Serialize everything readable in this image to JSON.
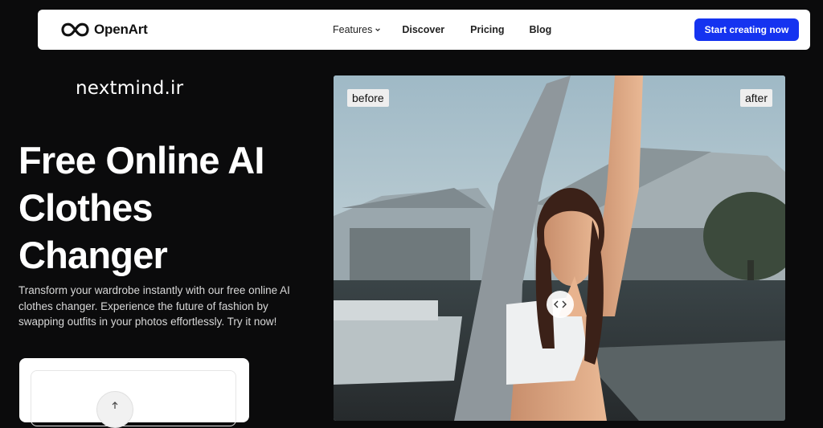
{
  "nav": {
    "brand": "OpenArt",
    "links": [
      "Features",
      "Discover",
      "Pricing",
      "Blog"
    ],
    "cta": "Start creating now"
  },
  "watermark": "nextmind.ir",
  "hero": {
    "title_lines": [
      "Free Online AI",
      "Clothes",
      "Changer"
    ],
    "subtitle": "Transform your wardrobe instantly with our free online AI clothes changer. Experience the future of fashion by swapping outfits in your photos effortlessly. Try it now!"
  },
  "compare": {
    "before_label": "before",
    "after_label": "after"
  },
  "icons": {
    "logo": "infinity-logo-icon",
    "features_dropdown": "chevron-down-icon",
    "upload": "arrow-up-icon",
    "slider": "chevron-left-right-icon"
  },
  "colors": {
    "page_bg": "#0b0b0c",
    "cta_bg": "#1533f0",
    "nav_bg": "#ffffff"
  }
}
